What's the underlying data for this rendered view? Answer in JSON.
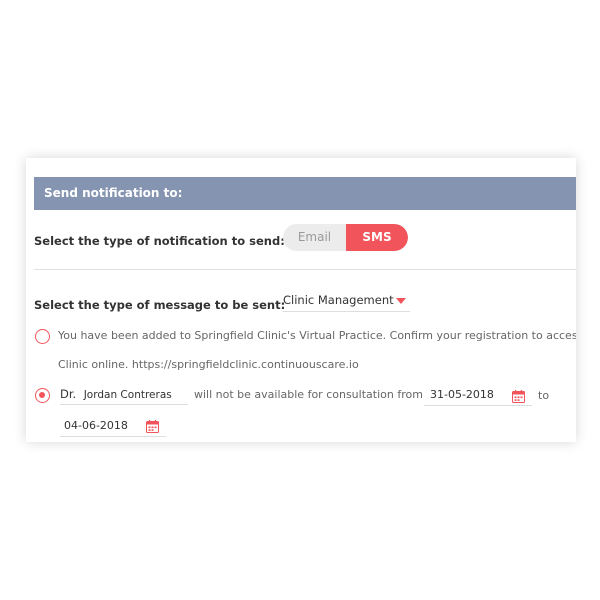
{
  "header": {
    "title": "Send notification to:"
  },
  "notification_type": {
    "label": "Select the type of notification to send:",
    "options": [
      "Email",
      "SMS"
    ],
    "selected": "SMS"
  },
  "message_type": {
    "label": "Select the type of message to be sent:",
    "selected_value": "Clinic Management"
  },
  "message_options": {
    "option1": {
      "line1": "You have been added to Springfield Clinic's Virtual Practice. Confirm your registration to access S",
      "line2": "Clinic online. https://springfieldclinic.continuouscare.io"
    },
    "option2": {
      "prefix": "Dr.",
      "doctor_name": "Jordan Contreras",
      "middle_text": "will not be available for consultation from",
      "from_date": "31-05-2018",
      "to_text": "to",
      "to_date": "04-06-2018"
    }
  },
  "colors": {
    "accent": "#f2545b",
    "header_bg": "#8594b0"
  },
  "icons": {
    "dropdown": "caret-down-icon",
    "date": "calendar-icon"
  }
}
